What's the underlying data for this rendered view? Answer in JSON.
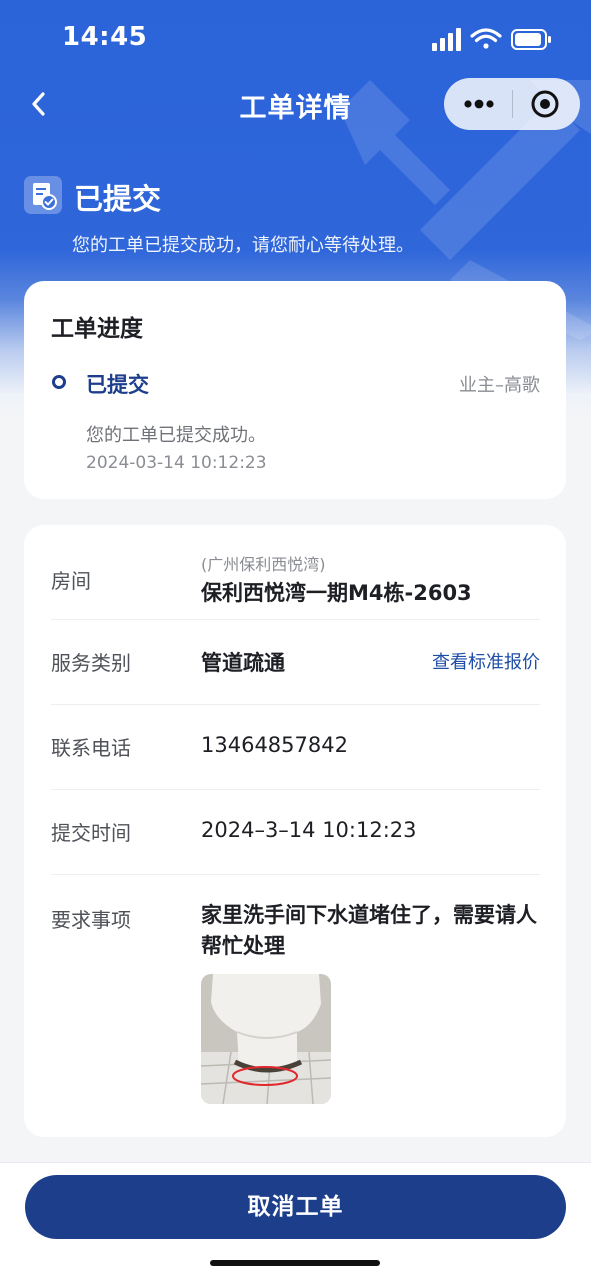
{
  "status_bar": {
    "time": "14:45"
  },
  "nav": {
    "title": "工单详情"
  },
  "state": {
    "title": "已提交",
    "description": "您的工单已提交成功，请您耐心等待处理。"
  },
  "progress": {
    "title": "工单进度",
    "status": "已提交",
    "owner": "业主–高歌",
    "message": "您的工单已提交成功。",
    "time": "2024-03-14 10:12:23"
  },
  "details": {
    "room": {
      "label": "房间",
      "project": "(广州保利西悦湾)",
      "value": "保利西悦湾一期M4栋-2603"
    },
    "service": {
      "label": "服务类别",
      "value": "管道疏通",
      "link": "查看标准报价"
    },
    "phone": {
      "label": "联系电话",
      "value": "13464857842"
    },
    "submit_time": {
      "label": "提交时间",
      "value": "2024–3–14 10:12:23"
    },
    "requirement": {
      "label": "要求事项",
      "value": "家里洗手间下水道堵住了，需要请人帮忙处理"
    }
  },
  "actions": {
    "cancel_label": "取消工单"
  },
  "colors": {
    "header_blue": "#2f66da",
    "primary_navy": "#1d3e8b",
    "link_blue": "#1e4ea6"
  },
  "icons": [
    "signal-icon",
    "wifi-icon",
    "battery-icon",
    "back-icon",
    "more-icon",
    "target-icon",
    "document-check-icon",
    "wrench-hammer-watermark"
  ]
}
